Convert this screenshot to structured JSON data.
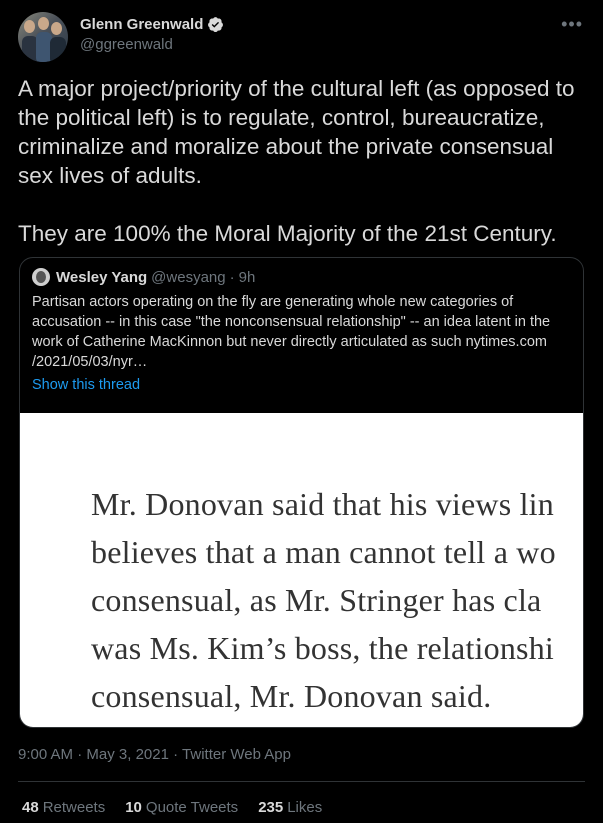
{
  "author": {
    "name": "Glenn Greenwald",
    "handle": "@ggreenwald",
    "verified_color": "#1d9bf0"
  },
  "tweet": {
    "paragraph_1": "A major project/priority of the cultural left (as opposed to the political left) is to regulate, control, bureaucratize, criminalize and moralize about the private consensual sex lives of adults.",
    "paragraph_2": "They are 100% the Moral Majority of the 21st Century."
  },
  "quoted": {
    "name": "Wesley Yang",
    "handle": "@wesyang",
    "separator": "·",
    "time": "9h",
    "body": "Partisan actors operating on the fly are generating whole new categories of accusation -- in this case \"the nonconsensual relationship\" --  an idea latent in the work of Catherine MacKinnon but never directly articulated as such nytimes.com\n/2021/05/03/nyr…",
    "show_thread": "Show this thread",
    "image_lines": [
      "Mr. Donovan said that his views lin",
      "believes that a man cannot tell a wo",
      "consensual, as Mr. Stringer has cla",
      "was Ms. Kim’s boss, the relationshi",
      "consensual, Mr. Donovan said."
    ]
  },
  "meta": {
    "time": "9:00 AM",
    "separator": "·",
    "date": "May 3, 2021",
    "app": "Twitter Web App"
  },
  "stats": {
    "retweets_count": "48",
    "retweets_label": "Retweets",
    "quotes_count": "10",
    "quotes_label": "Quote Tweets",
    "likes_count": "235",
    "likes_label": "Likes"
  },
  "colors": {
    "background": "#000000",
    "text": "#d9d9d9",
    "muted": "#6e767d",
    "link": "#1d9bf0",
    "border": "#2f3336"
  },
  "icons": {
    "more": "more-dots-icon",
    "verified": "verified-badge-icon"
  }
}
